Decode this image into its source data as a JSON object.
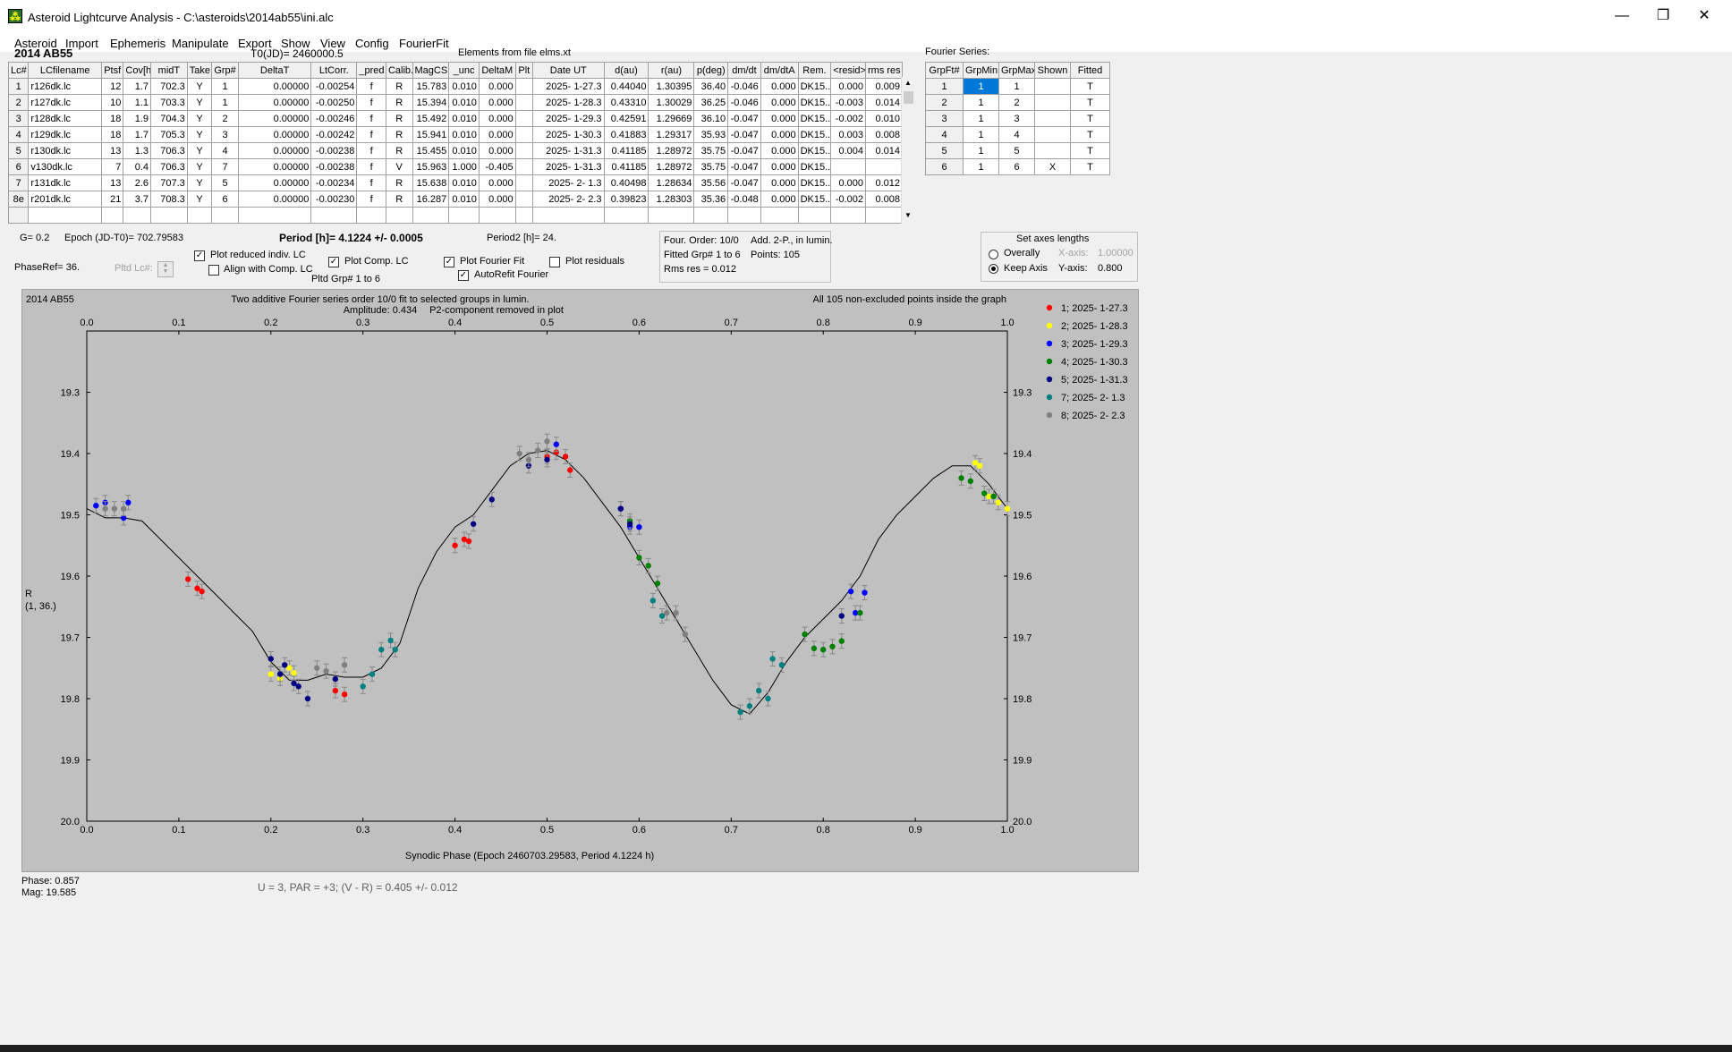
{
  "window": {
    "title": "Asteroid Lightcurve Analysis - C:\\asteroids\\2014ab55\\ini.alc",
    "icon": "app-icon",
    "controls": [
      "minimize-icon",
      "restore-icon",
      "close-icon"
    ]
  },
  "menu": [
    "Asteroid",
    "Import",
    "Ephemeris",
    "Manipulate",
    "Export",
    "Show",
    "View",
    "Config",
    "FourierFit"
  ],
  "header": {
    "asteroid": "2014 AB55",
    "t0": "T0(JD)= 2460000.5",
    "elements": "Elements from file elms.xt"
  },
  "lc_table": {
    "columns": [
      "Lc#",
      "LCfilename",
      "Ptsf",
      "Cov[h]",
      "midT",
      "Take",
      "Grp#",
      "DeltaT",
      "LtCorr.",
      "_pred",
      "Calib.",
      "MagCS",
      "_unc",
      "DeltaM",
      "Plt",
      "Date UT",
      "d(au)",
      "r(au)",
      "p(deg)",
      "dm/dt",
      "dm/dtA",
      "Rem.",
      "<resid>",
      "rms res"
    ],
    "rows": [
      [
        "1",
        "r126dk.lc",
        "12",
        "1.7",
        "702.3",
        "Y",
        "1",
        "0.00000",
        "-0.00254",
        "f",
        "R",
        "15.783",
        "0.010",
        "0.000",
        "",
        "2025- 1-27.3",
        "0.44040",
        "1.30395",
        "36.40",
        "-0.046",
        "0.000",
        "DK15..",
        "0.000",
        "0.009"
      ],
      [
        "2",
        "r127dk.lc",
        "10",
        "1.1",
        "703.3",
        "Y",
        "1",
        "0.00000",
        "-0.00250",
        "f",
        "R",
        "15.394",
        "0.010",
        "0.000",
        "",
        "2025- 1-28.3",
        "0.43310",
        "1.30029",
        "36.25",
        "-0.046",
        "0.000",
        "DK15..",
        "-0.003",
        "0.014"
      ],
      [
        "3",
        "r128dk.lc",
        "18",
        "1.9",
        "704.3",
        "Y",
        "2",
        "0.00000",
        "-0.00246",
        "f",
        "R",
        "15.492",
        "0.010",
        "0.000",
        "",
        "2025- 1-29.3",
        "0.42591",
        "1.29669",
        "36.10",
        "-0.047",
        "0.000",
        "DK15..",
        "-0.002",
        "0.010"
      ],
      [
        "4",
        "r129dk.lc",
        "18",
        "1.7",
        "705.3",
        "Y",
        "3",
        "0.00000",
        "-0.00242",
        "f",
        "R",
        "15.941",
        "0.010",
        "0.000",
        "",
        "2025- 1-30.3",
        "0.41883",
        "1.29317",
        "35.93",
        "-0.047",
        "0.000",
        "DK15..",
        "0.003",
        "0.008"
      ],
      [
        "5",
        "r130dk.lc",
        "13",
        "1.3",
        "706.3",
        "Y",
        "4",
        "0.00000",
        "-0.00238",
        "f",
        "R",
        "15.455",
        "0.010",
        "0.000",
        "",
        "2025- 1-31.3",
        "0.41185",
        "1.28972",
        "35.75",
        "-0.047",
        "0.000",
        "DK15..",
        "0.004",
        "0.014"
      ],
      [
        "6",
        "v130dk.lc",
        "7",
        "0.4",
        "706.3",
        "Y",
        "7",
        "0.00000",
        "-0.00238",
        "f",
        "V",
        "15.963",
        "1.000",
        "-0.405",
        "",
        "2025- 1-31.3",
        "0.41185",
        "1.28972",
        "35.75",
        "-0.047",
        "0.000",
        "DK15..",
        "",
        ""
      ],
      [
        "7",
        "r131dk.lc",
        "13",
        "2.6",
        "707.3",
        "Y",
        "5",
        "0.00000",
        "-0.00234",
        "f",
        "R",
        "15.638",
        "0.010",
        "0.000",
        "",
        "2025- 2- 1.3",
        "0.40498",
        "1.28634",
        "35.56",
        "-0.047",
        "0.000",
        "DK15..",
        "0.000",
        "0.012"
      ],
      [
        "8e",
        "r201dk.lc",
        "21",
        "3.7",
        "708.3",
        "Y",
        "6",
        "0.00000",
        "-0.00230",
        "f",
        "R",
        "16.287",
        "0.010",
        "0.000",
        "",
        "2025- 2- 2.3",
        "0.39823",
        "1.28303",
        "35.36",
        "-0.048",
        "0.000",
        "DK15..",
        "-0.002",
        "0.008"
      ]
    ]
  },
  "fourier_series": {
    "label": "Fourier Series:",
    "columns": [
      "GrpFt#",
      "GrpMin",
      "GrpMax",
      "Shown",
      "Fitted"
    ],
    "rows": [
      [
        "1",
        "1",
        "1",
        "",
        "T"
      ],
      [
        "2",
        "1",
        "2",
        "",
        "T"
      ],
      [
        "3",
        "1",
        "3",
        "",
        "T"
      ],
      [
        "4",
        "1",
        "4",
        "",
        "T"
      ],
      [
        "5",
        "1",
        "5",
        "",
        "T"
      ],
      [
        "6",
        "1",
        "6",
        "X",
        "T"
      ]
    ]
  },
  "controls": {
    "g": "G= 0.2",
    "epoch": "Epoch (JD-T0)= 702.79583",
    "period": "Period [h]= 4.1224 +/- 0.0005",
    "period2": "Period2 [h]= 24.",
    "phaseref": "PhaseRef= 36.",
    "pltd_lc": "Pltd Lc#:",
    "plot_reduced": "Plot reduced indiv. LC",
    "align_comp": "Align with Comp. LC",
    "plot_comp": "Plot Comp. LC",
    "pltd_grp": "Pltd Grp#  1   to   6",
    "plot_fourier": "Plot Fourier Fit",
    "autorefit": "AutoRefit Fourier",
    "plot_residuals": "Plot residuals",
    "four_order": "Four. Order: 10/0",
    "add2p": "Add. 2-P., in lumin.",
    "fitted_grp": "Fitted Grp# 1 to 6",
    "points": "Points: 105",
    "rms": "Rms res      = 0.012",
    "axes_title": "Set axes lengths",
    "overally": "Overally",
    "xaxis": "X-axis:",
    "xaxis_val": "1.00000",
    "keep_axis": "Keep Axis",
    "yaxis": "Y-axis:",
    "yaxis_val": "0.800"
  },
  "chart_data": {
    "type": "scatter",
    "title": "Two additive Fourier series order 10/0 fit to selected groups in lumin.",
    "subtitle": "Amplitude: 0.434",
    "note": "P2-component removed in plot",
    "object": "2014 AB55",
    "points_note": "All 105 non-excluded points inside the graph",
    "xlabel": "Synodic Phase (Epoch 2460703.29583, Period 4.1224 h)",
    "ylabel": "R",
    "ylabel2": "(1, 36.)",
    "xlim": [
      0.0,
      1.0
    ],
    "ylim": [
      20.0,
      19.2
    ],
    "xticks": [
      "0.0",
      "0.1",
      "0.2",
      "0.3",
      "0.4",
      "0.5",
      "0.6",
      "0.7",
      "0.8",
      "0.9",
      "1.0"
    ],
    "yticks": [
      "19.3",
      "19.4",
      "19.5",
      "19.6",
      "19.7",
      "19.8",
      "19.9",
      "20.0"
    ],
    "ytick_values": [
      19.3,
      19.4,
      19.5,
      19.6,
      19.7,
      19.8,
      19.9,
      20.0
    ],
    "curve": [
      [
        0.0,
        19.49
      ],
      [
        0.02,
        19.505
      ],
      [
        0.04,
        19.505
      ],
      [
        0.06,
        19.51
      ],
      [
        0.08,
        19.54
      ],
      [
        0.1,
        19.57
      ],
      [
        0.12,
        19.6
      ],
      [
        0.14,
        19.63
      ],
      [
        0.16,
        19.66
      ],
      [
        0.18,
        19.69
      ],
      [
        0.2,
        19.74
      ],
      [
        0.22,
        19.77
      ],
      [
        0.24,
        19.77
      ],
      [
        0.26,
        19.76
      ],
      [
        0.28,
        19.765
      ],
      [
        0.3,
        19.765
      ],
      [
        0.32,
        19.75
      ],
      [
        0.34,
        19.71
      ],
      [
        0.36,
        19.62
      ],
      [
        0.38,
        19.56
      ],
      [
        0.4,
        19.52
      ],
      [
        0.42,
        19.5
      ],
      [
        0.44,
        19.46
      ],
      [
        0.46,
        19.42
      ],
      [
        0.48,
        19.4
      ],
      [
        0.5,
        19.395
      ],
      [
        0.52,
        19.41
      ],
      [
        0.54,
        19.44
      ],
      [
        0.56,
        19.48
      ],
      [
        0.58,
        19.52
      ],
      [
        0.6,
        19.57
      ],
      [
        0.62,
        19.62
      ],
      [
        0.64,
        19.67
      ],
      [
        0.66,
        19.72
      ],
      [
        0.68,
        19.77
      ],
      [
        0.7,
        19.81
      ],
      [
        0.72,
        19.825
      ],
      [
        0.74,
        19.79
      ],
      [
        0.76,
        19.74
      ],
      [
        0.78,
        19.7
      ],
      [
        0.8,
        19.67
      ],
      [
        0.82,
        19.64
      ],
      [
        0.84,
        19.6
      ],
      [
        0.86,
        19.54
      ],
      [
        0.88,
        19.5
      ],
      [
        0.9,
        19.47
      ],
      [
        0.92,
        19.44
      ],
      [
        0.94,
        19.42
      ],
      [
        0.96,
        19.42
      ],
      [
        0.98,
        19.45
      ],
      [
        1.0,
        19.49
      ]
    ],
    "series": [
      {
        "name": "1; 2025- 1-27.3",
        "color": "#ff0000",
        "points": [
          [
            0.11,
            19.605
          ],
          [
            0.12,
            19.62
          ],
          [
            0.125,
            19.625
          ],
          [
            0.27,
            19.787
          ],
          [
            0.28,
            19.793
          ],
          [
            0.4,
            19.55
          ],
          [
            0.41,
            19.54
          ],
          [
            0.415,
            19.543
          ],
          [
            0.5,
            19.405
          ],
          [
            0.51,
            19.398
          ],
          [
            0.52,
            19.405
          ],
          [
            0.525,
            19.427
          ]
        ]
      },
      {
        "name": "2; 2025- 1-28.3",
        "color": "#ffff00",
        "points": [
          [
            0.2,
            19.76
          ],
          [
            0.21,
            19.767
          ],
          [
            0.22,
            19.75
          ],
          [
            0.225,
            19.758
          ],
          [
            0.965,
            19.415
          ],
          [
            0.97,
            19.42
          ],
          [
            0.98,
            19.47
          ],
          [
            0.99,
            19.48
          ],
          [
            1.0,
            19.49
          ]
        ]
      },
      {
        "name": "3; 2025- 1-29.3",
        "color": "#0000ff",
        "points": [
          [
            0.01,
            19.485
          ],
          [
            0.02,
            19.48
          ],
          [
            0.04,
            19.505
          ],
          [
            0.045,
            19.48
          ],
          [
            0.58,
            19.49
          ],
          [
            0.59,
            19.52
          ],
          [
            0.6,
            19.52
          ],
          [
            0.83,
            19.625
          ],
          [
            0.835,
            19.66
          ],
          [
            0.845,
            19.627
          ],
          [
            0.51,
            19.385
          ]
        ]
      },
      {
        "name": "4; 2025- 1-30.3",
        "color": "#008000",
        "points": [
          [
            0.59,
            19.51
          ],
          [
            0.6,
            19.57
          ],
          [
            0.61,
            19.583
          ],
          [
            0.62,
            19.612
          ],
          [
            0.78,
            19.695
          ],
          [
            0.79,
            19.718
          ],
          [
            0.8,
            19.72
          ],
          [
            0.81,
            19.715
          ],
          [
            0.82,
            19.706
          ],
          [
            0.84,
            19.66
          ],
          [
            0.95,
            19.44
          ],
          [
            0.96,
            19.445
          ],
          [
            0.975,
            19.465
          ],
          [
            0.985,
            19.47
          ]
        ]
      },
      {
        "name": "5; 2025- 1-31.3",
        "color": "#000080",
        "points": [
          [
            0.2,
            19.735
          ],
          [
            0.21,
            19.76
          ],
          [
            0.215,
            19.745
          ],
          [
            0.225,
            19.775
          ],
          [
            0.23,
            19.78
          ],
          [
            0.24,
            19.8
          ],
          [
            0.27,
            19.768
          ],
          [
            0.42,
            19.515
          ],
          [
            0.44,
            19.475
          ],
          [
            0.48,
            19.42
          ],
          [
            0.5,
            19.41
          ],
          [
            0.58,
            19.49
          ],
          [
            0.59,
            19.515
          ],
          [
            0.82,
            19.665
          ]
        ]
      },
      {
        "name": "7; 2025- 2- 1.3",
        "color": "#008080",
        "points": [
          [
            0.3,
            19.78
          ],
          [
            0.31,
            19.76
          ],
          [
            0.32,
            19.72
          ],
          [
            0.33,
            19.705
          ],
          [
            0.335,
            19.72
          ],
          [
            0.615,
            19.64
          ],
          [
            0.625,
            19.665
          ],
          [
            0.71,
            19.822
          ],
          [
            0.72,
            19.812
          ],
          [
            0.73,
            19.787
          ],
          [
            0.74,
            19.8
          ],
          [
            0.745,
            19.735
          ],
          [
            0.755,
            19.745
          ]
        ]
      },
      {
        "name": "8; 2025- 2- 2.3",
        "color": "#808080",
        "points": [
          [
            0.02,
            19.49
          ],
          [
            0.03,
            19.49
          ],
          [
            0.04,
            19.49
          ],
          [
            0.25,
            19.75
          ],
          [
            0.26,
            19.755
          ],
          [
            0.28,
            19.745
          ],
          [
            0.47,
            19.4
          ],
          [
            0.48,
            19.41
          ],
          [
            0.49,
            19.395
          ],
          [
            0.5,
            19.38
          ],
          [
            0.63,
            19.66
          ],
          [
            0.64,
            19.66
          ],
          [
            0.65,
            19.695
          ]
        ]
      }
    ]
  },
  "status": {
    "phase": "Phase:  0.857",
    "mag": "Mag:    19.585",
    "formula": "U = 3, PAR = +3; (V - R) = 0.405 +/- 0.012"
  }
}
